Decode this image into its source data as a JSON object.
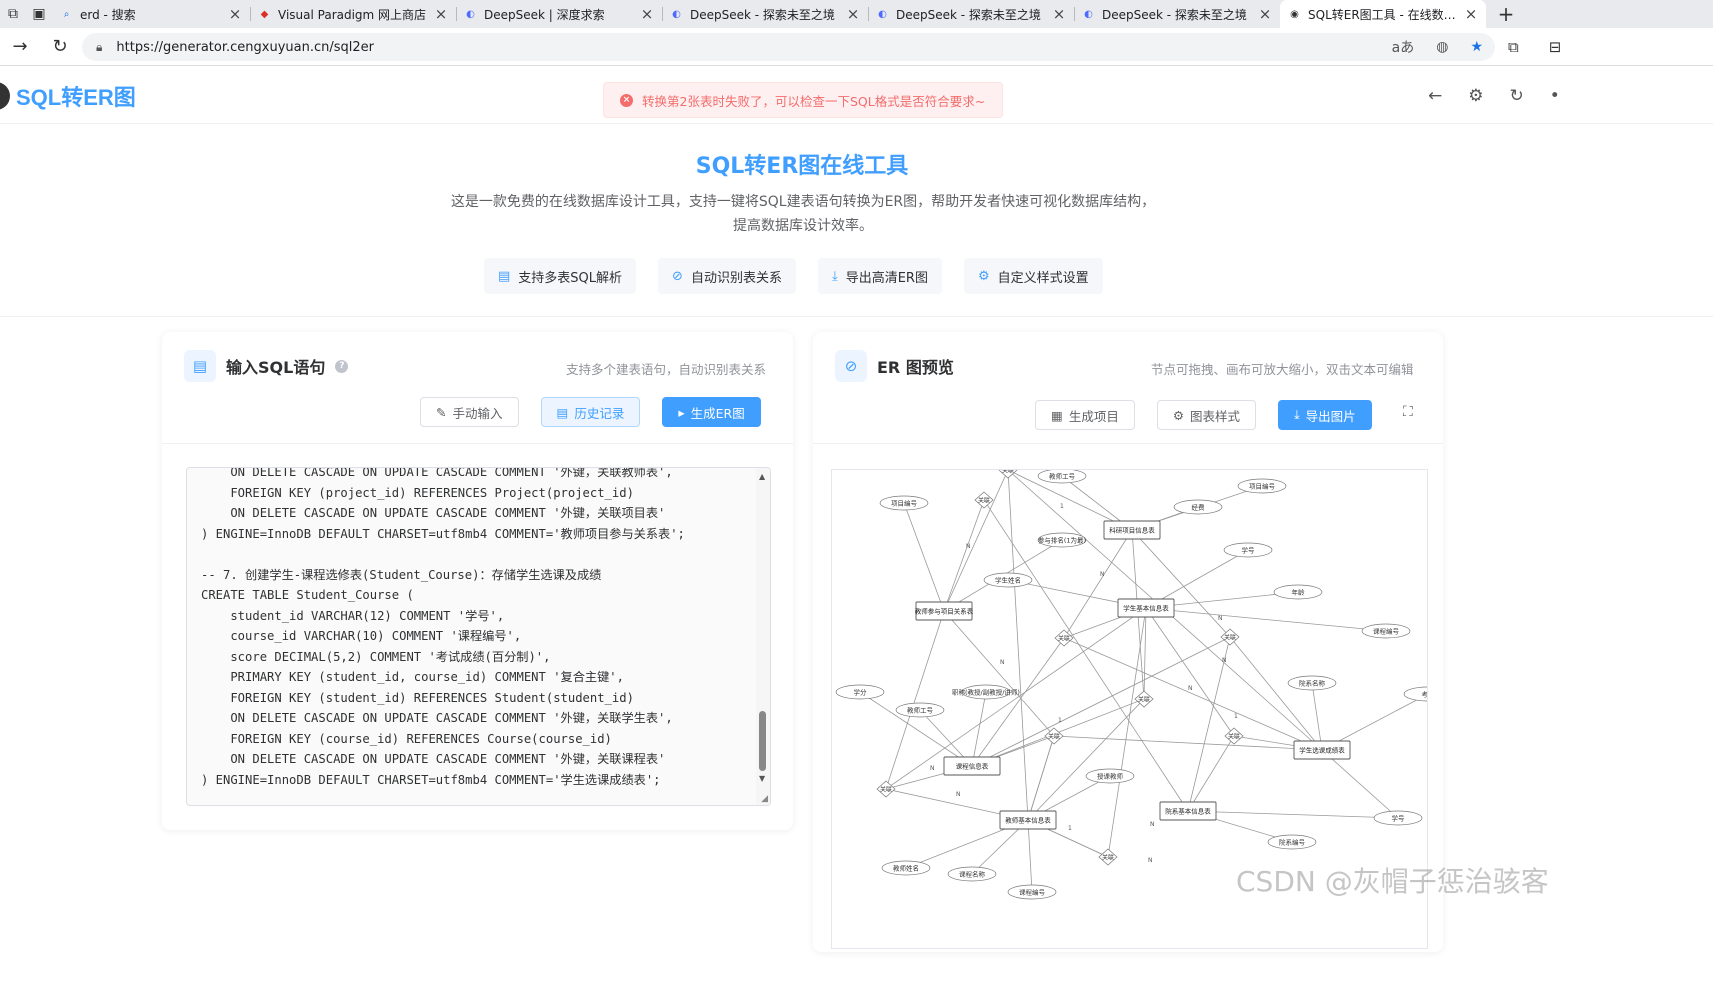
{
  "browser": {
    "tabs": [
      {
        "title": "erd - 搜索",
        "fav": "🔍"
      },
      {
        "title": "Visual Paradigm 网上商店",
        "fav": "◆"
      },
      {
        "title": "DeepSeek | 深度求索",
        "fav": "◐"
      },
      {
        "title": "DeepSeek - 探索未至之境",
        "fav": "◐"
      },
      {
        "title": "DeepSeek - 探索未至之境",
        "fav": "◐"
      },
      {
        "title": "DeepSeek - 探索未至之境",
        "fav": "◐"
      },
      {
        "title": "SQL转ER图工具 - 在线数据库设计",
        "fav": "◉"
      }
    ],
    "url": "https://generator.cengxuyuan.cn/sql2er"
  },
  "app": {
    "logo": "SQL转ER图",
    "alert": "转换第2张表时失败了，可以检查一下SQL格式是否符合要求~",
    "hero_title": "SQL转ER图在线工具",
    "hero_desc": "这是一款免费的在线数据库设计工具，支持一键将SQL建表语句转换为ER图，帮助开发者快速可视化数据库结构，提高数据库设计效率。",
    "features": [
      "支持多表SQL解析",
      "自动识别表关系",
      "导出高清ER图",
      "自定义样式设置"
    ]
  },
  "left_card": {
    "title": "输入SQL语句",
    "subtitle": "支持多个建表语句，自动识别表关系",
    "buttons": {
      "manual": "手动输入",
      "history": "历史记录",
      "generate": "生成ER图"
    },
    "code": "    ON DELETE CASCADE ON UPDATE CASCADE COMMENT '外键，关联教师表',\n    FOREIGN KEY (project_id) REFERENCES Project(project_id)\n    ON DELETE CASCADE ON UPDATE CASCADE COMMENT '外键，关联项目表'\n) ENGINE=InnoDB DEFAULT CHARSET=utf8mb4 COMMENT='教师项目参与关系表';\n\n-- 7. 创建学生-课程选修表(Student_Course)：存储学生选课及成绩\nCREATE TABLE Student_Course (\n    student_id VARCHAR(12) COMMENT '学号',\n    course_id VARCHAR(10) COMMENT '课程编号',\n    score DECIMAL(5,2) COMMENT '考试成绩(百分制)',\n    PRIMARY KEY (student_id, course_id) COMMENT '复合主键',\n    FOREIGN KEY (student_id) REFERENCES Student(student_id)\n    ON DELETE CASCADE ON UPDATE CASCADE COMMENT '外键，关联学生表',\n    FOREIGN KEY (course_id) REFERENCES Course(course_id)\n    ON DELETE CASCADE ON UPDATE CASCADE COMMENT '外键，关联课程表'\n) ENGINE=InnoDB DEFAULT CHARSET=utf8mb4 COMMENT='学生选课成绩表';"
  },
  "right_card": {
    "title": "ER 图预览",
    "subtitle": "节点可拖拽、画布可放大缩小，双击文本可编辑",
    "buttons": {
      "project": "生成项目",
      "style": "图表样式",
      "export": "导出图片"
    }
  },
  "er_labels": {
    "entities": [
      "教师参与项目关系表",
      "科研项目信息表",
      "学生基本信息表",
      "课程信息表",
      "教师基本信息表",
      "院系基本信息表",
      "学生选课成绩表"
    ],
    "attributes": [
      "项目编号",
      "教师工号",
      "项目编号",
      "经费",
      "参与排名(1为最)",
      "学号",
      "学生姓名",
      "年龄",
      "课程编号",
      "院系名称",
      "学分",
      "职称(教授/副教授/讲师)",
      "教师工号",
      "授课教师",
      "考试",
      "教师姓名",
      "课程名称",
      "课程编号",
      "院系编号",
      "学号"
    ],
    "relations": [
      "关联",
      "关联",
      "关联",
      "关联",
      "关联",
      "关联",
      "关联",
      "关联",
      "关联"
    ],
    "cardinality": [
      "N",
      "1",
      "N",
      "N",
      "1",
      "N",
      "N",
      "N",
      "1",
      "N",
      "N",
      "1",
      "N",
      "N"
    ]
  },
  "watermark": "CSDN @灰帽子惩治骇客"
}
